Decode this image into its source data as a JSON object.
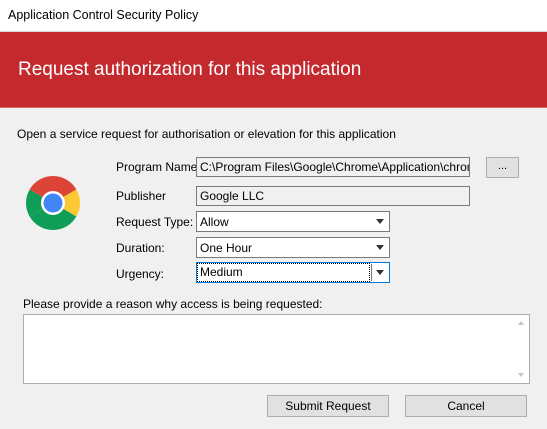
{
  "window": {
    "title": "Application Control Security Policy"
  },
  "banner": {
    "heading": "Request authorization for this application",
    "color": "#c4292e"
  },
  "intro": "Open a service request for authorisation or elevation for this application",
  "app_icon": "chrome-logo",
  "form": {
    "program_name": {
      "label": "Program Name",
      "value": "C:\\Program Files\\Google\\Chrome\\Application\\chrome.exe",
      "browse_label": "..."
    },
    "publisher": {
      "label": "Publisher",
      "value": "Google LLC"
    },
    "request_type": {
      "label": "Request Type:",
      "value": "Allow"
    },
    "duration": {
      "label": "Duration:",
      "value": "One Hour"
    },
    "urgency": {
      "label": "Urgency:",
      "value": "Medium"
    }
  },
  "reason": {
    "label": "Please provide a reason why access is being requested:",
    "value": ""
  },
  "buttons": {
    "submit": "Submit Request",
    "cancel": "Cancel"
  }
}
